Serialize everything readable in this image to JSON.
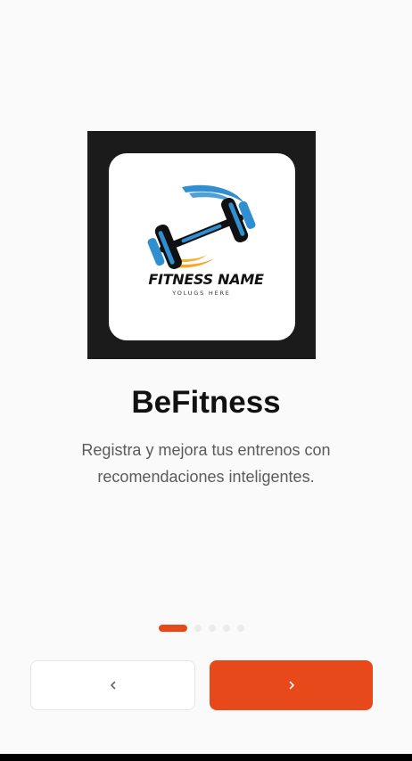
{
  "app": {
    "title": "BeFitness",
    "description": "Registra y mejora tus entrenos con recomendaciones inteligentes."
  },
  "logo": {
    "brand_name": "FITNESS NAME",
    "tagline": "YOLUGS HERE",
    "icon": "dumbbell-icon"
  },
  "pager": {
    "total": 5,
    "current": 1
  },
  "navigation": {
    "prev_icon": "chevron-left-icon",
    "next_icon": "chevron-right-icon"
  },
  "colors": {
    "accent": "#e8491a",
    "logo_blue": "#2f8fd0",
    "logo_orange": "#f5a623",
    "logo_frame": "#1c1b1b"
  }
}
